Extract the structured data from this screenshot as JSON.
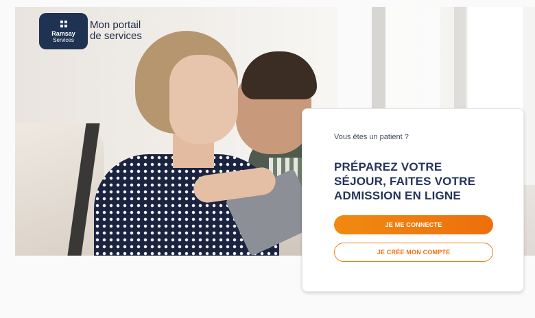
{
  "brand": {
    "logo_name": "Ramsay",
    "logo_sub": "Services",
    "portal_line1": "Mon portail",
    "portal_line2": "de services",
    "color": "#1f3251"
  },
  "hero": {
    "image": "couple-with-tablet-photo"
  },
  "card": {
    "pretitle": "Vous êtes un patient ?",
    "title": "PRÉPAREZ VOTRE SÉJOUR, FAITES VOTRE ADMISSION EN LIGNE",
    "login_label": "JE ME CONNECTE",
    "signup_label": "JE CRÉE MON COMPTE",
    "accent_color": "#ee7d12",
    "title_color": "#24345a"
  }
}
